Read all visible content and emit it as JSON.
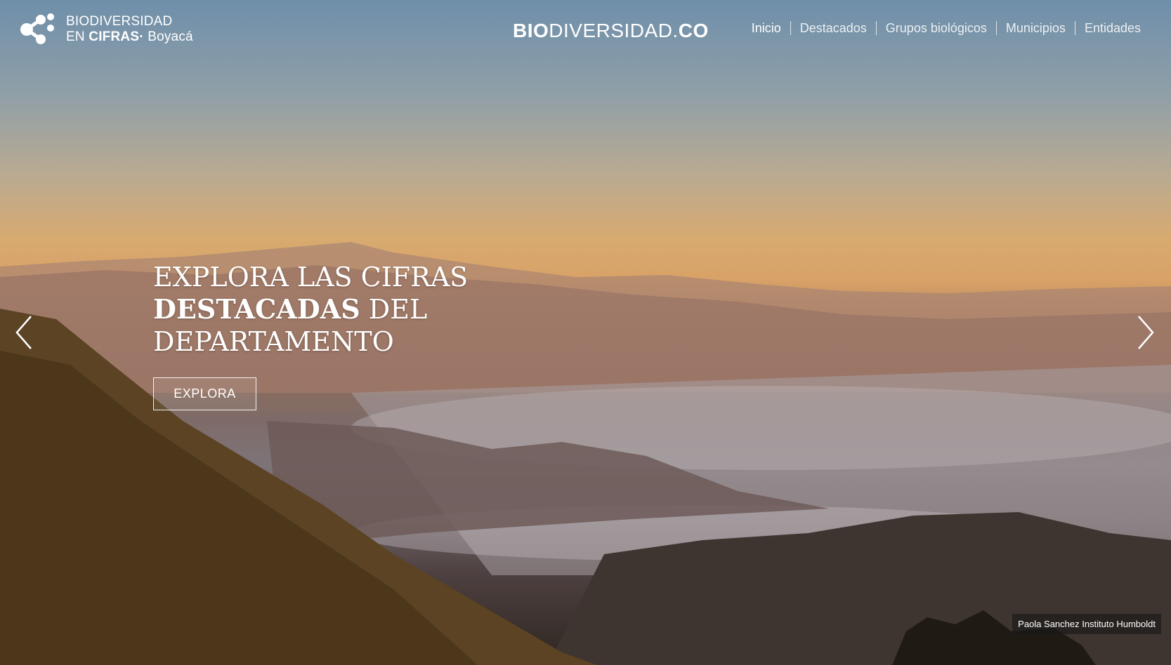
{
  "logo": {
    "line1": "BIODIVERSIDAD",
    "line2_prefix": "EN ",
    "line2_strong": "CIFRAS·",
    "line2_suffix": " Boyacá"
  },
  "center_brand": {
    "part1": "BIO",
    "part2": "DIVERSIDAD.",
    "part3": "CO"
  },
  "nav": {
    "items": [
      "Inicio",
      "Destacados",
      "Grupos biológicos",
      "Municipios",
      "Entidades"
    ]
  },
  "hero": {
    "headline_line1": "EXPLORA LAS CIFRAS",
    "headline_line2_bold": "DESTACADAS",
    "headline_line2_rest": " DEL",
    "headline_line3": "DEPARTAMENTO",
    "button_label": "EXPLORA",
    "icons": {
      "prev": "chevron-left-icon",
      "next": "chevron-right-icon"
    }
  },
  "photo_credit": "Paola Sanchez Instituto Humboldt",
  "colors": {
    "text": "#ffffff"
  }
}
